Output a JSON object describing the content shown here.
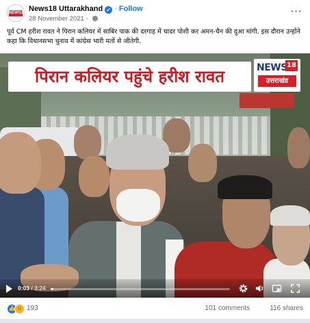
{
  "post": {
    "page_name": "News18 Uttarakhand",
    "follow_label": "Follow",
    "date": "28 November 2021",
    "separator": "·",
    "more_icon": "more-dots-icon",
    "avatar_text": "NEWS18",
    "caption": "पूर्व CM हरीश रावत ने पिरान कलियर में साबिर पाक की दरगाह में चादर पोशी कर अमन-चैन की दुआ मांगी. इस दौरान उन्होंने कहा कि विधानसभा चुनाव में कांग्रेस भारी मतों से जीतेगी."
  },
  "video": {
    "banner_text": "पिरान कलियर पहुंचे हरीश रावत",
    "logo": {
      "news": "NEWS",
      "number": "18",
      "region": "उत्तराखंड"
    },
    "time_current": "0:03",
    "time_separator": " / ",
    "time_total": "3:24",
    "progress": 0.015,
    "controls": [
      "play-icon",
      "settings-gear-icon",
      "volume-icon",
      "pip-icon",
      "fullscreen-icon"
    ]
  },
  "stats": {
    "reaction_count": "193",
    "comments": "101 comments",
    "shares": "116 shares"
  },
  "colors": {
    "brand_blue": "#1877f2",
    "news18_red": "#d81e26",
    "banner_text": "#d1161d"
  }
}
